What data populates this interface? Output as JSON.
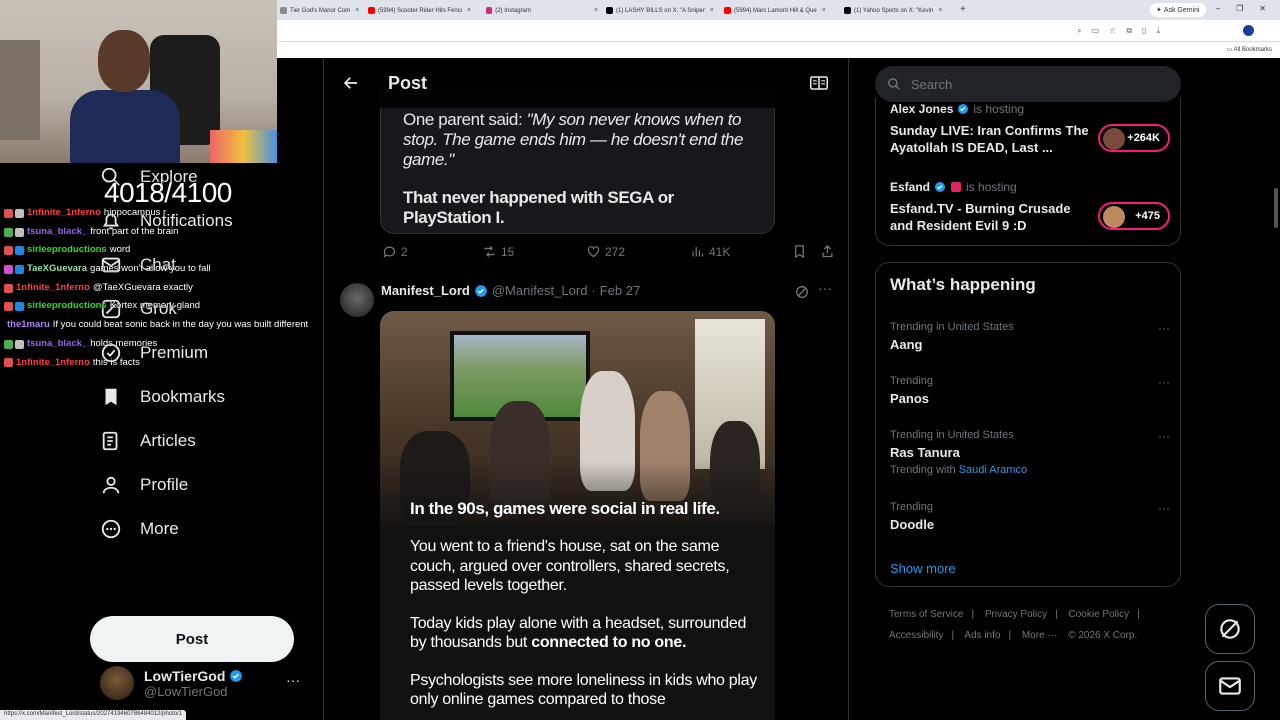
{
  "browser": {
    "tabs": [
      {
        "label": "Tier God's Manor Com",
        "fav": "#888"
      },
      {
        "label": "(5994) Scooter Rider Hits Fenci",
        "fav": "#ff0000"
      },
      {
        "label": "(2) Instagram",
        "fav": "#d62976"
      },
      {
        "label": "(1) LASHY BILLS on X: \"A Sniper",
        "fav": "#000000"
      },
      {
        "label": "(5994) Marc Lamont Hill & Que",
        "fav": "#ff0000"
      },
      {
        "label": "(1) Yahoo Sports on X: \"Kevin",
        "fav": "#000000"
      }
    ],
    "ask_gemini": "Ask Gemini",
    "all_bookmarks": "All Bookmarks",
    "status_url": "https://x.com/Manifest_Lord/status/2027419460786484012/photo/1"
  },
  "stream": {
    "followers": "4018/4100",
    "chat": [
      {
        "user": "1nfinite_1nferno",
        "msg": "hippocampus r",
        "color": "#ff3b3b",
        "badges": [
          "#e05050",
          "#c0c0c0"
        ]
      },
      {
        "user": "tsuna_black_",
        "msg": "front part of the brain",
        "color": "#9b5cf6",
        "badges": [
          "#4caf50",
          "#c0c0c0"
        ]
      },
      {
        "user": "sirleeproductions",
        "msg": "word",
        "color": "#22dd22",
        "badges": [
          "#e05050",
          "#1e88e5"
        ]
      },
      {
        "user": "TaeXGuevara",
        "msg": "games won't allow you to fall",
        "color": "#8fe0a0",
        "badges": [
          "#d04fd0",
          "#1e88e5"
        ]
      },
      {
        "user": "1nfinite_1nferno",
        "msg": "@TaeXGuevara exactly",
        "color": "#ff3b3b",
        "badges": [
          "#e05050"
        ]
      },
      {
        "user": "sirleeproductions",
        "msg": "Kortex memory gland",
        "color": "#22dd22",
        "badges": [
          "#e05050",
          "#1e88e5"
        ]
      },
      {
        "user": "the1maru",
        "msg": "If you could beat sonic back in the day you was built different",
        "color": "#b07cff",
        "badges": []
      },
      {
        "user": "tsuna_black_",
        "msg": "holds memories",
        "color": "#9b5cf6",
        "badges": [
          "#4caf50",
          "#c0c0c0"
        ]
      },
      {
        "user": "1nfinite_1nferno",
        "msg": "this is facts",
        "color": "#ff3b3b",
        "badges": [
          "#e05050"
        ]
      }
    ]
  },
  "nav": {
    "items": [
      {
        "label": "Explore",
        "icon": "search-icon"
      },
      {
        "label": "Notifications",
        "icon": "bell-icon"
      },
      {
        "label": "Chat",
        "icon": "chat-icon"
      },
      {
        "label": "Grok",
        "icon": "grok-icon"
      },
      {
        "label": "Premium",
        "icon": "premium-icon"
      },
      {
        "label": "Bookmarks",
        "icon": "bookmark-icon"
      },
      {
        "label": "Articles",
        "icon": "articles-icon"
      },
      {
        "label": "Profile",
        "icon": "profile-icon"
      },
      {
        "label": "More",
        "icon": "more-icon"
      }
    ],
    "post_label": "Post",
    "account": {
      "name": "LowTierGod",
      "handle": "@LowTierGod"
    }
  },
  "center": {
    "title": "Post",
    "tweet1": {
      "quote_lead": "One parent said: ",
      "quote_italic": "\"My son never knows when to stop. The game ends him — he doesn't end the game.\"",
      "bold": "That never happened with SEGA or PlayStation I.",
      "replies": "2",
      "reposts": "15",
      "likes": "272",
      "views": "41K"
    },
    "tweet2": {
      "name": "Manifest_Lord",
      "handle": "@Manifest_Lord",
      "sep": "·",
      "date": "Feb 27",
      "headline": "In the 90s, games were social in real life.",
      "para1": "You went to a friend's house, sat on the same couch, argued over controllers, shared secrets, passed levels together.",
      "para2_lead": "Today kids play alone with a headset, surrounded by thousands but ",
      "para2_bold": "connected to no one.",
      "para3": "Psychologists see more loneliness in kids who play only online games compared to those"
    }
  },
  "right": {
    "search_placeholder": "Search",
    "spaces": [
      {
        "host": "Alex Jones",
        "hosting": "is hosting",
        "title": "Sunday LIVE: Iran Confirms The Ayatollah IS DEAD, Last ...",
        "count": "+264K"
      },
      {
        "host": "Esfand",
        "hosting": "is hosting",
        "title": "Esfand.TV - Burning Crusade and Resident Evil 9 :D",
        "count": "+475"
      }
    ],
    "trends_title": "What’s happening",
    "trends": [
      {
        "context": "Trending in United States",
        "name": "Aang",
        "sub_lead": "",
        "sub_link": ""
      },
      {
        "context": "Trending",
        "name": "Panos",
        "sub_lead": "",
        "sub_link": ""
      },
      {
        "context": "Trending in United States",
        "name": "Ras Tanura",
        "sub_lead": "Trending with ",
        "sub_link": "Saudi Aramco"
      },
      {
        "context": "Trending",
        "name": "Doodle",
        "sub_lead": "",
        "sub_link": ""
      }
    ],
    "show_more": "Show more",
    "footer": [
      "Terms of Service",
      "Privacy Policy",
      "Cookie Policy",
      "Accessibility",
      "Ads info",
      "More ···",
      "© 2026 X Corp."
    ]
  }
}
